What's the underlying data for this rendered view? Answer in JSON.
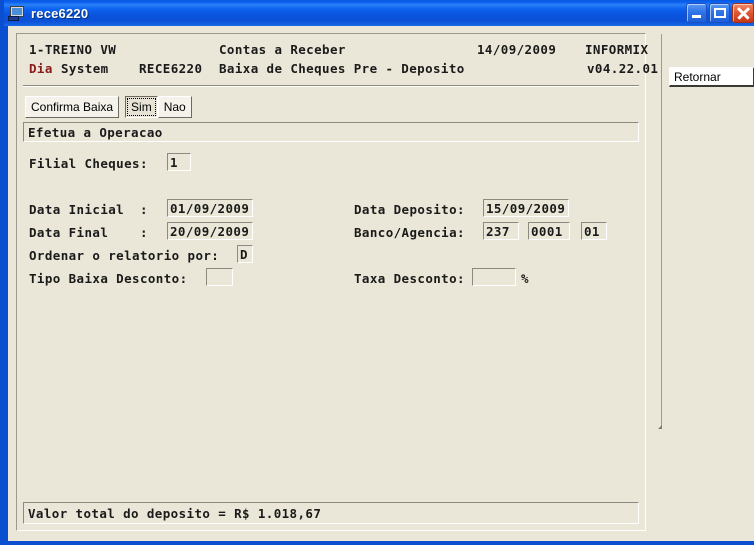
{
  "window": {
    "title": "rece6220",
    "icon": "computer-monitor-icon",
    "minimize_label": "Minimizar",
    "maximize_label": "Maximizar",
    "close_label": "Fechar"
  },
  "header": {
    "company": "1-TREINO VW",
    "module": "Contas a Receber",
    "date": "14/09/2009",
    "database": "INFORMIX",
    "system_prefix": "Dia",
    "system_name": "System",
    "program_code": "RECE6220",
    "screen_title": "Baixa de Cheques Pre - Deposito",
    "version": "v04.22.01",
    "accent_color": "#8b1a1a"
  },
  "toolbar": {
    "prompt_label": "Confirma Baixa",
    "yes_label": "Sim",
    "no_label": "Nao",
    "selected": "Sim"
  },
  "message": {
    "text": "Efetua a Operacao"
  },
  "form": {
    "filial_label": "Filial Cheques:",
    "filial_value": "1",
    "data_inicial_label": "Data Inicial  :",
    "data_inicial_value": "01/09/2009",
    "data_final_label": "Data Final    :",
    "data_final_value": "20/09/2009",
    "ordenar_label": "Ordenar o relatorio por:",
    "ordenar_value": "D",
    "tipo_baixa_label": "Tipo Baixa Desconto:",
    "tipo_baixa_value": "",
    "data_deposito_label": "Data Deposito:",
    "data_deposito_value": "15/09/2009",
    "banco_agencia_label": "Banco/Agencia:",
    "banco_value": "237",
    "agencia_value": "0001",
    "conta_value": "01",
    "taxa_desconto_label": "Taxa Desconto:",
    "taxa_desconto_value": "",
    "taxa_suffix": "%"
  },
  "status": {
    "text": "Valor total do deposito = R$ 1.018,67"
  },
  "sidebar": {
    "retornar_label": "Retornar"
  },
  "colors": {
    "background": "#eae7d8",
    "titlebar_blue": "#0b60ef",
    "frame_blue": "#0a4fd0",
    "text": "#1a1a1a"
  }
}
